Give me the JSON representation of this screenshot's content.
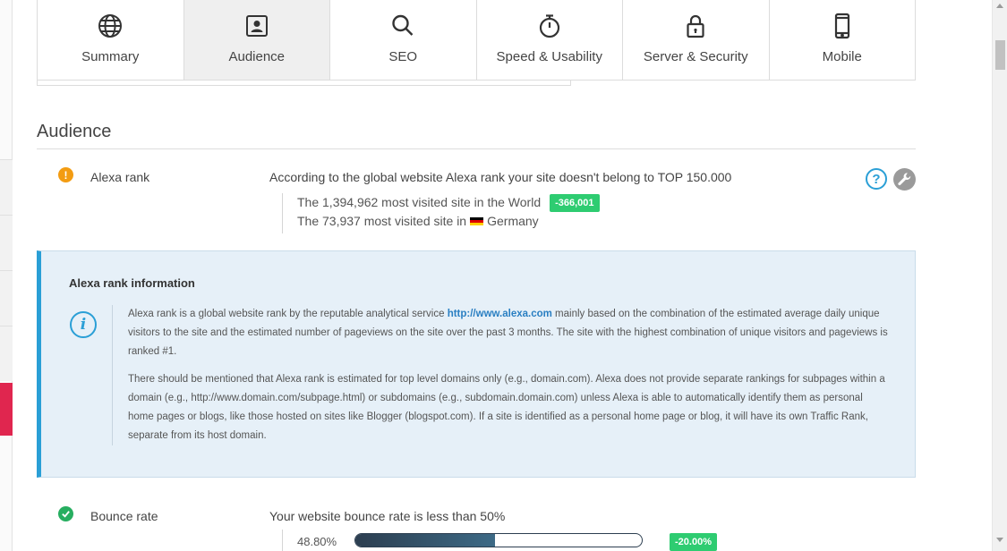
{
  "tabs": [
    {
      "label": "Summary",
      "icon": "globe-icon",
      "active": false
    },
    {
      "label": "Audience",
      "icon": "contact-card-icon",
      "active": true
    },
    {
      "label": "SEO",
      "icon": "search-icon",
      "active": false
    },
    {
      "label": "Speed & Usability",
      "icon": "stopwatch-icon",
      "active": false
    },
    {
      "label": "Server & Security",
      "icon": "lock-icon",
      "active": false
    },
    {
      "label": "Mobile",
      "icon": "mobile-phone-icon",
      "active": false
    }
  ],
  "section": {
    "title": "Audience"
  },
  "alexa": {
    "label": "Alexa rank",
    "status": "warning",
    "description": "According to the global website Alexa rank your site doesn't belong to TOP 150.000",
    "world_line": "The 1,394,962 most visited site in the World",
    "world_change": "-366,001",
    "country_prefix": "The 73,937 most visited site in",
    "country": "Germany",
    "help_icon_text": "?"
  },
  "info": {
    "title": "Alexa rank information",
    "icon_text": "i",
    "p1_before": "Alexa rank is a global website rank by the reputable analytical service ",
    "p1_link": "http://www.alexa.com",
    "p1_after": " mainly based on the combination of the estimated average daily unique visitors to the site and the estimated number of pageviews on the site over the past 3 months. The site with the highest combination of unique visitors and pageviews is ranked #1.",
    "p2": "There should be mentioned that Alexa rank is estimated for top level domains only (e.g., domain.com). Alexa does not provide separate rankings for subpages within a domain (e.g., http://www.domain.com/subpage.html) or subdomains (e.g., subdomain.domain.com) unless Alexa is able to automatically identify them as personal home pages or blogs, like those hosted on sites like Blogger (blogspot.com). If a site is identified as a personal home page or blog, it will have its own Traffic Rank, separate from its host domain."
  },
  "bounce": {
    "label": "Bounce rate",
    "status": "ok",
    "description": "Your website bounce rate is less than 50%",
    "value": "48.80%",
    "percent": 48.8,
    "change": "-20.00%"
  },
  "colors": {
    "accent_blue": "#2a9fd6",
    "warning": "#f39c12",
    "success": "#2ecc71",
    "sidebar_accent": "#e0264f"
  }
}
